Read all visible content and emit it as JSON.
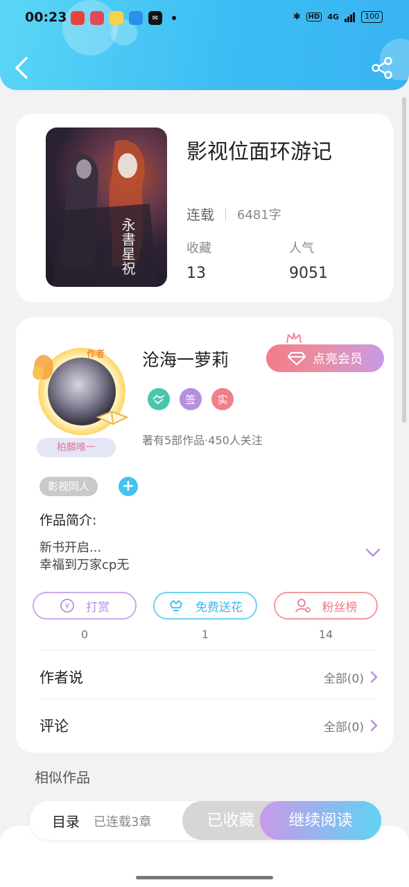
{
  "status_bar": {
    "time": "00:23",
    "network": "4G",
    "battery": "100"
  },
  "book": {
    "title": "影视位面环游记",
    "status": "连载",
    "word_count": "6481字",
    "favorites_label": "收藏",
    "favorites": "13",
    "popularity_label": "人气",
    "popularity": "9051",
    "cover_text": "永書星祝"
  },
  "author": {
    "badge": "作者",
    "name": "沧海一萝莉",
    "name_tag": "柏麟唯一",
    "vip_label": "点亮会员",
    "badges": [
      "签",
      "实"
    ],
    "stats": "著有5部作品·450人关注"
  },
  "work": {
    "genre_tag": "影视同人",
    "add_tag": "+",
    "intro_label": "作品简介:",
    "intro_lines": [
      "新书开启...",
      "幸福到万家cp无"
    ]
  },
  "actions": [
    {
      "label": "打赏",
      "count": "0"
    },
    {
      "label": "免费送花",
      "count": "1"
    },
    {
      "label": "粉丝榜",
      "count": "14"
    }
  ],
  "rows": {
    "author_says": {
      "label": "作者说",
      "value": "全部(0)"
    },
    "comments": {
      "label": "评论",
      "value": "全部(0)"
    }
  },
  "similar_label": "相似作品",
  "bottom": {
    "toc": "目录",
    "chapters": "已连载3章",
    "collected": "已收藏",
    "read": "继续阅读"
  },
  "colors": {
    "header": "#3dbdf3",
    "accent_cyan": "#43c3ef",
    "accent_pink": "#f27c8a",
    "accent_purple": "#c89ae6"
  }
}
